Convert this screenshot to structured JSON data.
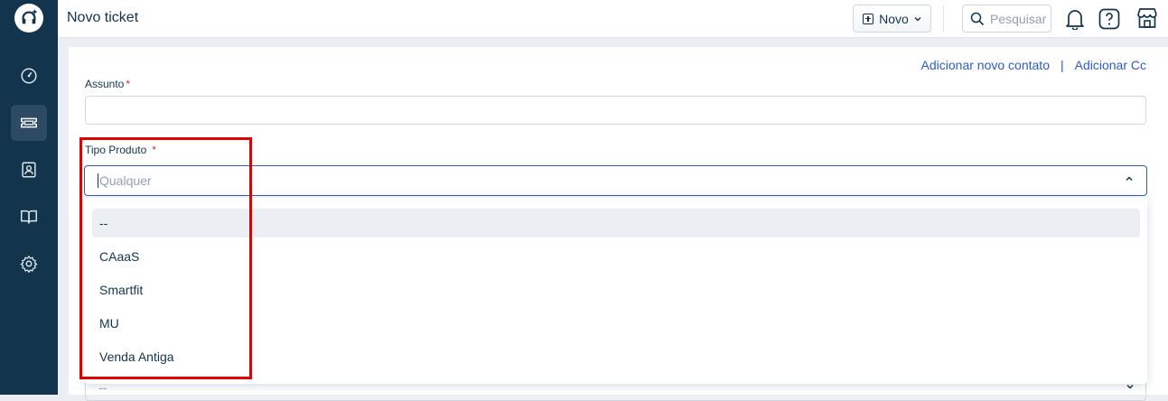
{
  "header": {
    "title": "Novo ticket",
    "new_button_label": "Novo",
    "search_placeholder": "Pesquisar"
  },
  "form": {
    "links": [
      "Adicionar novo contato",
      "|",
      "Adicionar Cc"
    ],
    "subject_label": "Assunto",
    "subject_value": "",
    "required_marker": "*",
    "product_type_label": "Tipo Produto",
    "product_type_placeholder": "Qualquer",
    "next_select_value": "--"
  },
  "dropdown": {
    "options": [
      "--",
      "CAaaS",
      "Smartfit",
      "MU",
      "Venda Antiga"
    ],
    "selected_index": 0
  },
  "colors": {
    "sidebar": "#12344d",
    "accent": "#2c5cc5",
    "required": "#d72d30",
    "annotation": "#e00000"
  },
  "icons": {
    "logo": "headset-plus-icon",
    "sidebar": [
      "dashboard-icon",
      "tickets-icon",
      "contacts-icon",
      "knowledge-base-icon",
      "settings-icon"
    ],
    "header": [
      "search-icon",
      "bell-icon",
      "help-icon",
      "marketplace-icon"
    ]
  }
}
